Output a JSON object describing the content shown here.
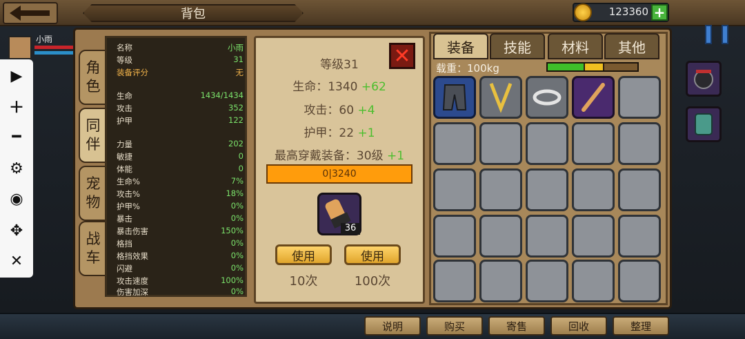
{
  "header": {
    "title": "背包",
    "gold": "123360",
    "gold_plus": "+"
  },
  "character": {
    "name": "小雨"
  },
  "side_tabs": [
    {
      "label": "角\n色"
    },
    {
      "label": "同\n伴"
    },
    {
      "label": "宠\n物"
    },
    {
      "label": "战\n车"
    }
  ],
  "stats": [
    {
      "k": "名称",
      "v": "小雨"
    },
    {
      "k": "等级",
      "v": "31"
    },
    {
      "k": "装备评分",
      "v": "无"
    },
    {
      "k": "生命",
      "v": "1434/1434"
    },
    {
      "k": "攻击",
      "v": "352"
    },
    {
      "k": "护甲",
      "v": "122"
    },
    {
      "k": "力量",
      "v": "202"
    },
    {
      "k": "敏捷",
      "v": "0"
    },
    {
      "k": "体能",
      "v": "0"
    },
    {
      "k": "生命%",
      "v": "7%"
    },
    {
      "k": "攻击%",
      "v": "18%"
    },
    {
      "k": "护甲%",
      "v": "0%"
    },
    {
      "k": "暴击",
      "v": "0%"
    },
    {
      "k": "暴击伤害",
      "v": "150%"
    },
    {
      "k": "格挡",
      "v": "0%"
    },
    {
      "k": "格挡效果",
      "v": "0%"
    },
    {
      "k": "闪避",
      "v": "0%"
    },
    {
      "k": "攻击速度",
      "v": "100%"
    },
    {
      "k": "伤害加深",
      "v": "0%"
    }
  ],
  "detail": {
    "level": "等级31",
    "hp": "生命：1340",
    "hp_gain": "+62",
    "atk": "攻击：60",
    "atk_gain": "+4",
    "armor": "护甲：22",
    "armor_gain": "+1",
    "max_equip": "最高穿戴装备：30级",
    "max_equip_gain": "+1",
    "exp": "0|3240",
    "exp_progress": 0,
    "item_count": "36",
    "use1": "使用",
    "use1_count": "10次",
    "use2": "使用",
    "use2_count": "100次"
  },
  "inventory": {
    "tabs": [
      "装备",
      "技能",
      "材料",
      "其他"
    ],
    "load_label": "载重：100kg",
    "load_segments_colors": [
      "#3fbf2a",
      "#f0c020",
      "#7a5a30"
    ]
  },
  "bottom": {
    "buttons": [
      "说明",
      "购买",
      "寄售",
      "回收",
      "整理"
    ]
  },
  "colors": {
    "stat_value": "#7be26b",
    "gain": "#4cbe2e",
    "exp": "#ff9c0c"
  }
}
